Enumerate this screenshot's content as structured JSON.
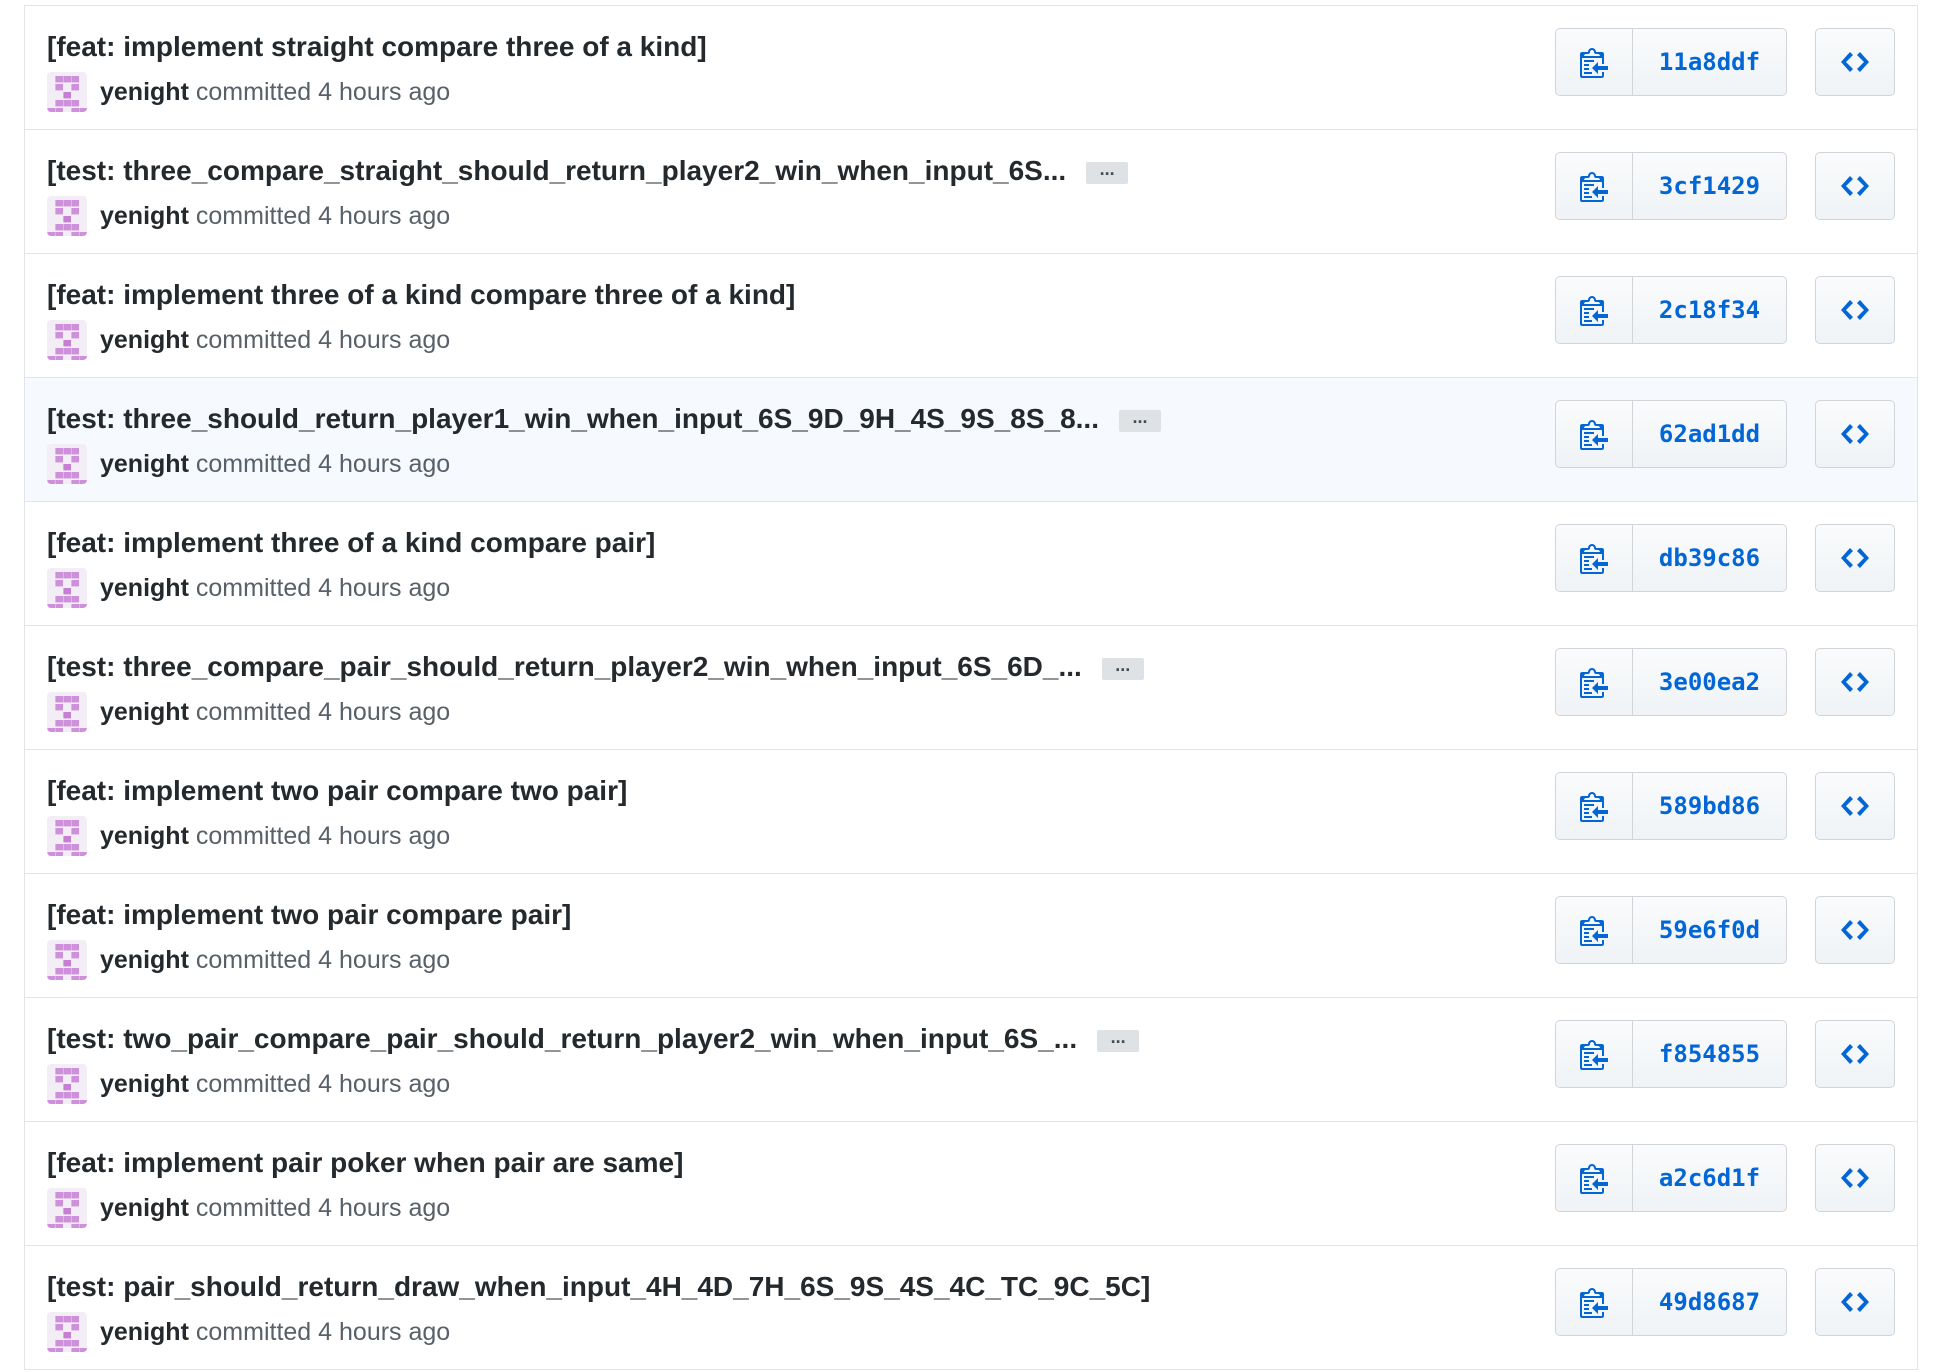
{
  "colors": {
    "link": "#0366d6",
    "title": "#24292e",
    "meta": "#586069",
    "border": "#e1e4e8",
    "highlight_row": "#f6f9fd",
    "avatar_identicon": "#c77fd6"
  },
  "icons": {
    "copy": "clippy-icon",
    "browse": "code-icon",
    "expand": "ellipsis-icon"
  },
  "commits": [
    {
      "title": "[feat: implement straight compare three of a kind]",
      "truncated": false,
      "author": "yenight",
      "meta": "committed 4 hours ago",
      "sha": "11a8ddf"
    },
    {
      "title": "[test: three_compare_straight_should_return_player2_win_when_input_6S...",
      "truncated": true,
      "ellipsis": "...",
      "author": "yenight",
      "meta": "committed 4 hours ago",
      "sha": "3cf1429"
    },
    {
      "title": "[feat: implement three of a kind compare three of a kind]",
      "truncated": false,
      "author": "yenight",
      "meta": "committed 4 hours ago",
      "sha": "2c18f34"
    },
    {
      "title": "[test: three_should_return_player1_win_when_input_6S_9D_9H_4S_9S_8S_8...",
      "truncated": true,
      "ellipsis": "...",
      "author": "yenight",
      "meta": "committed 4 hours ago",
      "sha": "62ad1dd",
      "highlighted": true
    },
    {
      "title": "[feat: implement three of a kind compare pair]",
      "truncated": false,
      "author": "yenight",
      "meta": "committed 4 hours ago",
      "sha": "db39c86"
    },
    {
      "title": "[test: three_compare_pair_should_return_player2_win_when_input_6S_6D_...",
      "truncated": true,
      "ellipsis": "...",
      "author": "yenight",
      "meta": "committed 4 hours ago",
      "sha": "3e00ea2"
    },
    {
      "title": "[feat: implement two pair compare two pair]",
      "truncated": false,
      "author": "yenight",
      "meta": "committed 4 hours ago",
      "sha": "589bd86"
    },
    {
      "title": "[feat: implement two pair compare pair]",
      "truncated": false,
      "author": "yenight",
      "meta": "committed 4 hours ago",
      "sha": "59e6f0d"
    },
    {
      "title": "[test: two_pair_compare_pair_should_return_player2_win_when_input_6S_...",
      "truncated": true,
      "ellipsis": "...",
      "author": "yenight",
      "meta": "committed 4 hours ago",
      "sha": "f854855"
    },
    {
      "title": "[feat: implement pair poker when pair are same]",
      "truncated": false,
      "author": "yenight",
      "meta": "committed 4 hours ago",
      "sha": "a2c6d1f"
    },
    {
      "title": "[test: pair_should_return_draw_when_input_4H_4D_7H_6S_9S_4S_4C_TC_9C_5C]",
      "truncated": false,
      "author": "yenight",
      "meta": "committed 4 hours ago",
      "sha": "49d8687"
    }
  ]
}
